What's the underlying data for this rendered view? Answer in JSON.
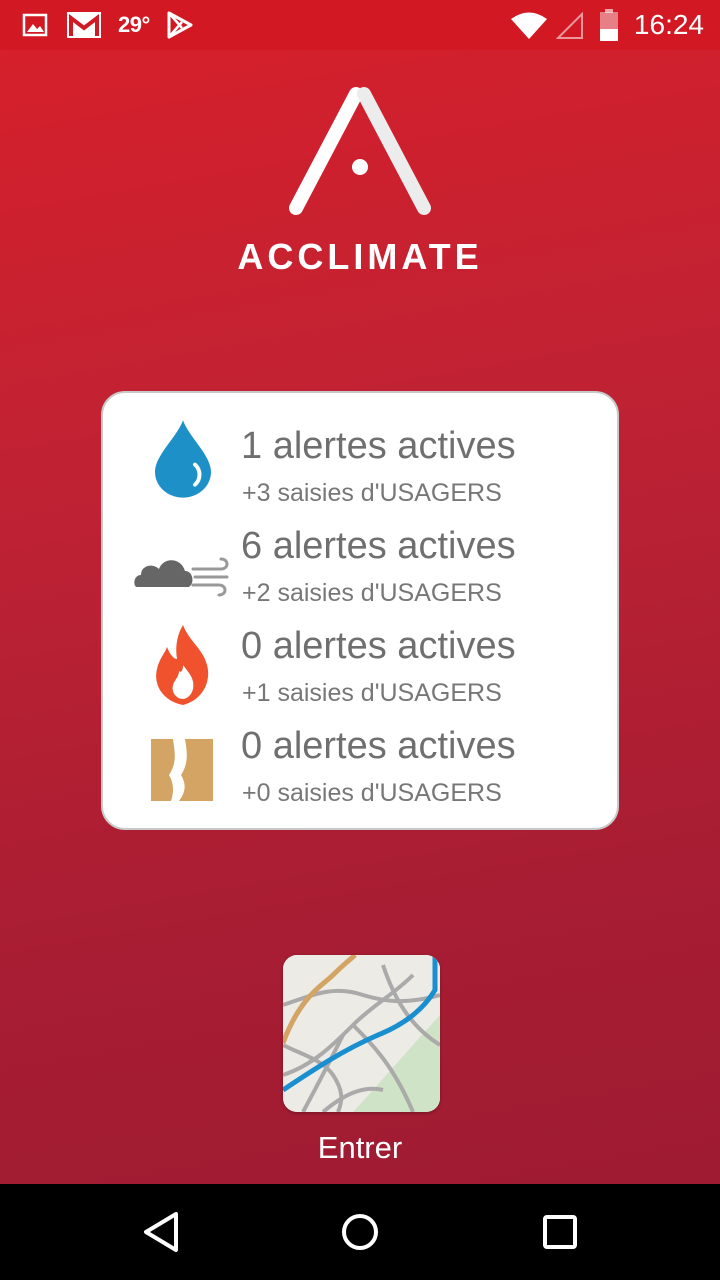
{
  "status_bar": {
    "temperature": "29°",
    "time": "16:24",
    "icons": [
      "image-notification-icon",
      "gmail-icon",
      "play-store-icon",
      "wifi-icon",
      "cell-signal-icon",
      "battery-icon"
    ]
  },
  "app": {
    "logo_text": "ACCLIMATE"
  },
  "alerts": [
    {
      "icon": "water-drop-icon",
      "title": "1 alertes actives",
      "subtitle": "+3 saisies d'USAGERS"
    },
    {
      "icon": "wind-cloud-icon",
      "title": "6 alertes actives",
      "subtitle": "+2 saisies d'USAGERS"
    },
    {
      "icon": "fire-icon",
      "title": "0 alertes actives",
      "subtitle": "+1 saisies d'USAGERS"
    },
    {
      "icon": "ground-crack-icon",
      "title": "0 alertes actives",
      "subtitle": "+0 saisies d'USAGERS"
    }
  ],
  "enter": {
    "label": "Entrer",
    "icon": "map-icon"
  },
  "nav": {
    "icons": [
      "back-icon",
      "home-icon",
      "recents-icon"
    ]
  },
  "colors": {
    "primary_red": "#d81f2a",
    "water_blue": "#1e90c8",
    "cloud_gray": "#6a6a6a",
    "fire_orange": "#f0522e",
    "ground_tan": "#d4a464"
  }
}
